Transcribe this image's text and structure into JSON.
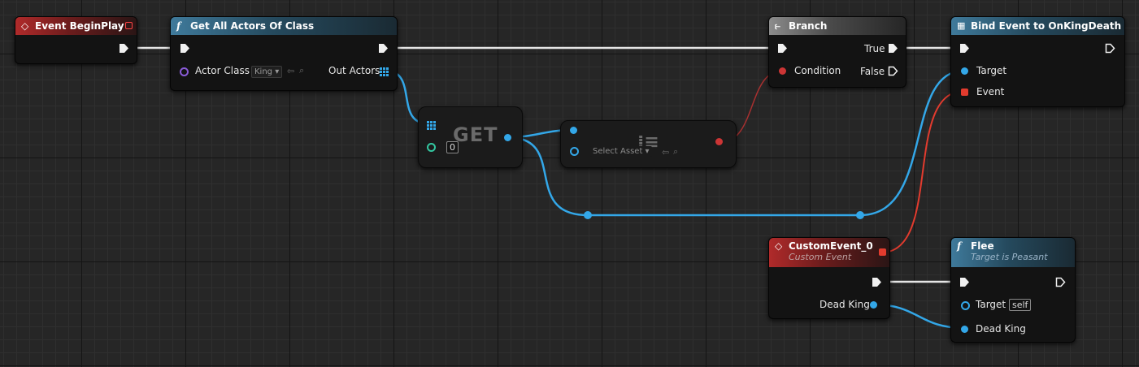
{
  "nodes": {
    "begin_play": {
      "title": "Event BeginPlay"
    },
    "get_all_actors": {
      "title": "Get All Actors Of Class",
      "actor_class_label": "Actor Class",
      "actor_class_value": "King",
      "out_actors_label": "Out Actors"
    },
    "get_array": {
      "title": "GET",
      "index_value": "0"
    },
    "is_valid": {
      "select_asset_label": "Select Asset"
    },
    "branch": {
      "title": "Branch",
      "true_label": "True",
      "false_label": "False",
      "condition_label": "Condition"
    },
    "bind_event": {
      "title": "Bind Event to OnKingDeath",
      "target_label": "Target",
      "event_label": "Event"
    },
    "custom_event": {
      "title": "CustomEvent_0",
      "subtitle": "Custom Event",
      "dead_king_label": "Dead King"
    },
    "flee": {
      "title": "Flee",
      "subtitle": "Target is Peasant",
      "target_label": "Target",
      "target_value": "self",
      "dead_king_label": "Dead King"
    }
  },
  "colors": {
    "event_header": "#b02a2a",
    "function_header": "#3f7a9b",
    "object_pin": "#33a7e8",
    "bool_pin": "#cc3535",
    "exec_wire": "#e6e6e6"
  }
}
